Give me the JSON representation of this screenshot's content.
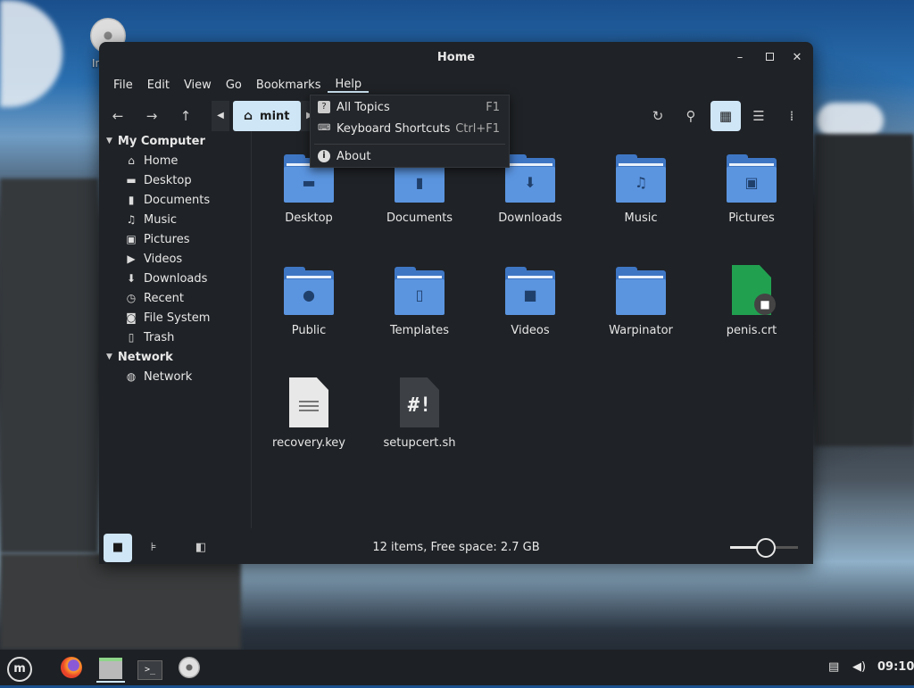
{
  "desktop": {
    "icon_label": "Install"
  },
  "window": {
    "title": "Home",
    "controls": {
      "minimize": "–",
      "maximize": "▫",
      "close": "✕"
    }
  },
  "menubar": [
    "File",
    "Edit",
    "View",
    "Go",
    "Bookmarks",
    "Help"
  ],
  "toolbar": {
    "breadcrumb": "mint",
    "back": "←",
    "forward": "→",
    "up": "↑"
  },
  "sidebar": {
    "sections": [
      {
        "title": "My Computer",
        "items": [
          "Home",
          "Desktop",
          "Documents",
          "Music",
          "Pictures",
          "Videos",
          "Downloads",
          "Recent",
          "File System",
          "Trash"
        ]
      },
      {
        "title": "Network",
        "items": [
          "Network"
        ]
      }
    ]
  },
  "files": [
    {
      "name": "Desktop",
      "kind": "folder",
      "icon": "desktop-icon"
    },
    {
      "name": "Documents",
      "kind": "folder",
      "icon": "document-icon"
    },
    {
      "name": "Downloads",
      "kind": "folder",
      "icon": "download-icon"
    },
    {
      "name": "Music",
      "kind": "folder",
      "icon": "music-note-icon"
    },
    {
      "name": "Pictures",
      "kind": "folder",
      "icon": "image-icon"
    },
    {
      "name": "Public",
      "kind": "folder",
      "icon": "person-icon"
    },
    {
      "name": "Templates",
      "kind": "folder",
      "icon": "template-icon"
    },
    {
      "name": "Videos",
      "kind": "folder",
      "icon": "video-camera-icon"
    },
    {
      "name": "Warpinator",
      "kind": "folder",
      "icon": ""
    },
    {
      "name": "penis.crt",
      "kind": "certificate",
      "icon": "certificate-lock-icon"
    },
    {
      "name": "recovery.key",
      "kind": "text",
      "icon": "text-file-icon"
    },
    {
      "name": "setupcert.sh",
      "kind": "script",
      "icon": "script-file-icon",
      "glyph": "#!"
    }
  ],
  "status": {
    "text": "12 items, Free space: 2.7 GB",
    "zoom_fraction": 0.5
  },
  "help_menu": {
    "items": [
      {
        "label": "All Topics",
        "accel": "F1",
        "icon": "help-icon"
      },
      {
        "label": "Keyboard Shortcuts",
        "accel": "Ctrl+F1",
        "icon": "keyboard-icon"
      },
      {
        "label": "About",
        "accel": "",
        "icon": "info-icon"
      }
    ]
  },
  "taskbar": {
    "clock": "09:10"
  },
  "colors": {
    "accent": "#cfe6f6",
    "folder": "#5b95e0",
    "window_bg": "#1f2226"
  }
}
